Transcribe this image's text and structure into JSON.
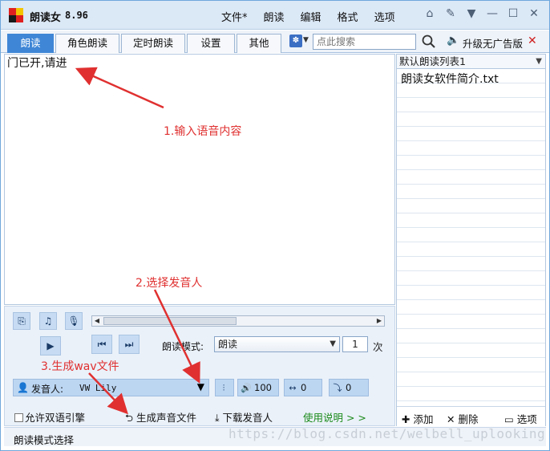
{
  "app": {
    "title": "朗读女",
    "version": "8.96"
  },
  "menu": [
    "文件*",
    "朗读",
    "编辑",
    "格式",
    "选项"
  ],
  "window_icons": [
    "home-icon",
    "tools-icon",
    "shirt-icon",
    "minimize-icon",
    "maximize-icon",
    "close-icon"
  ],
  "tabs": [
    {
      "label": "朗读",
      "active": true
    },
    {
      "label": "角色朗读",
      "active": false
    },
    {
      "label": "定时朗读",
      "active": false
    },
    {
      "label": "设置",
      "active": false
    },
    {
      "label": "其他",
      "active": false
    }
  ],
  "search": {
    "placeholder": "点此搜索"
  },
  "upgrade": {
    "label": "升级无广告版"
  },
  "editor": {
    "text": "门已开,请进"
  },
  "playlist": {
    "selected": "默认朗读列表1",
    "items": [
      "朗读女软件简介.txt"
    ],
    "add_label": "添加",
    "delete_label": "删除",
    "options_label": "选项"
  },
  "controls": {
    "mode_label": "朗读模式:",
    "mode_value": "朗读",
    "count_value": "1",
    "count_unit": "次",
    "voice_label": "发音人:",
    "voice_value": "VW Lily",
    "volume_value": "100",
    "speed_value": "0",
    "pitch_value": "0",
    "allow_dual_engine": "允许双语引擎",
    "generate_audio": "生成声音文件",
    "download_voice": "下载发音人",
    "help": "使用说明 > >"
  },
  "status": {
    "text": "朗读模式选择"
  },
  "watermark": "https://blog.csdn.net/welbell_uplooking",
  "annotations": [
    {
      "text": "1.输入语音内容"
    },
    {
      "text": "2.选择发音人"
    },
    {
      "text": "3.生成wav文件"
    }
  ],
  "colors": {
    "accent": "#3f86d6",
    "annotation": "#e03030",
    "help_link": "#1a8a1a",
    "close_x": "#d02020"
  }
}
